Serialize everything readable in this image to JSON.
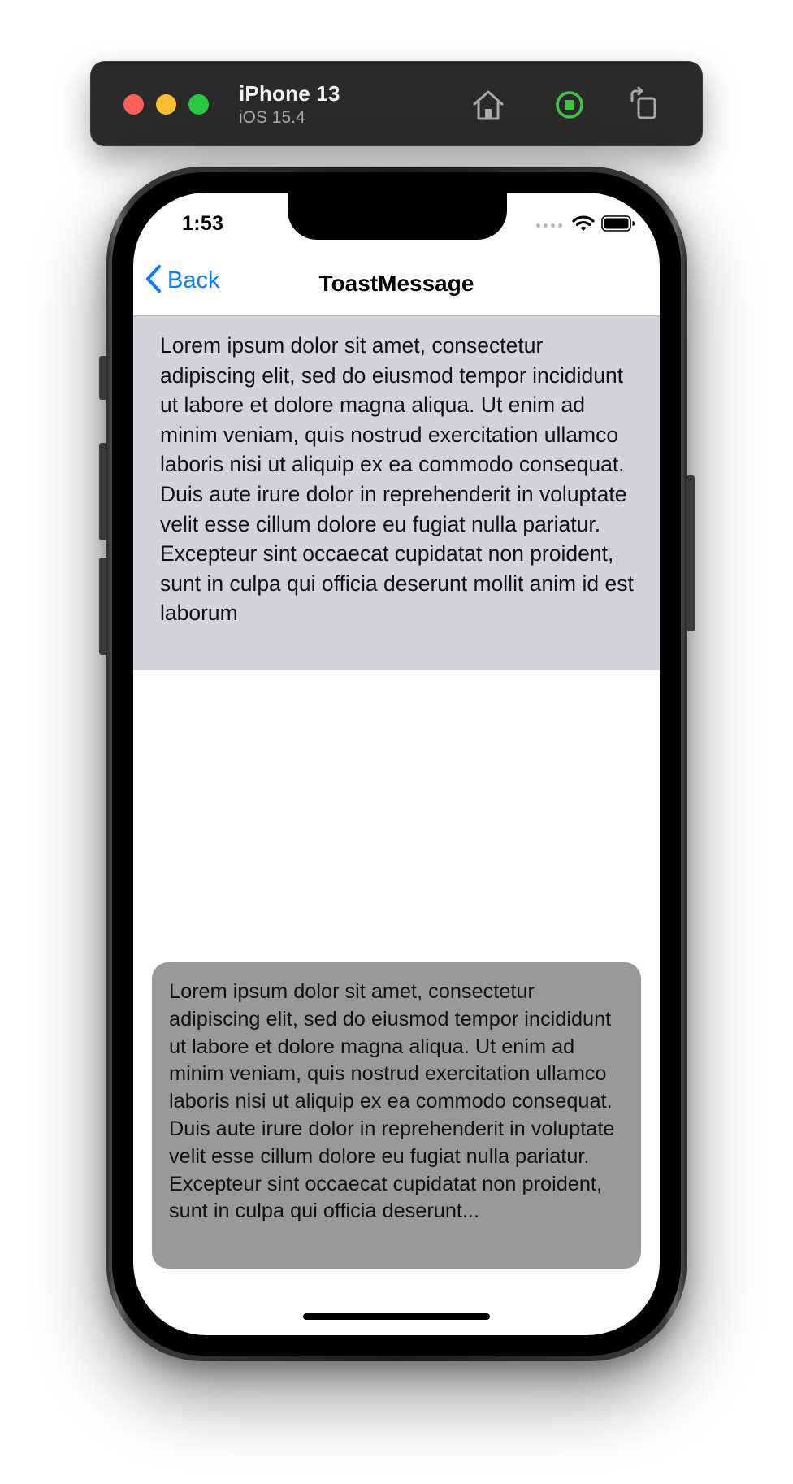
{
  "simulator": {
    "device_name": "iPhone 13",
    "os_version": "iOS 15.4",
    "icons": [
      "home-icon",
      "record-icon",
      "rotate-icon"
    ]
  },
  "status_bar": {
    "time": "1:53",
    "icons": [
      "cellular-dots-icon",
      "wifi-icon",
      "battery-icon"
    ]
  },
  "nav": {
    "back_label": "Back",
    "title": "ToastMessage"
  },
  "panel": {
    "text": "Lorem ipsum dolor sit amet, consectetur adipiscing elit, sed do eiusmod tempor incididunt ut labore et dolore magna aliqua. Ut enim ad minim veniam, quis nostrud exercitation ullamco laboris nisi ut aliquip ex ea commodo consequat. Duis aute irure dolor in reprehenderit in voluptate velit esse cillum dolore eu fugiat nulla pariatur. Excepteur sint occaecat cupidatat non proident, sunt in culpa qui officia deserunt mollit anim id est laborum"
  },
  "toast": {
    "text": "Lorem ipsum dolor sit amet, consectetur adipiscing elit, sed do eiusmod tempor incididunt ut labore et dolore magna aliqua. Ut enim ad minim veniam, quis nostrud exercitation ullamco laboris nisi ut aliquip ex ea commodo consequat. Duis aute irure dolor in reprehenderit in voluptate velit esse cillum dolore eu fugiat nulla pariatur. Excepteur sint occaecat cupidatat non proident, sunt in culpa qui officia deserunt..."
  },
  "colors": {
    "accent": "#0a7aff",
    "panel_background": "#d3d3d8",
    "toast_background": "#999999",
    "record_green": "#3fc44a"
  }
}
